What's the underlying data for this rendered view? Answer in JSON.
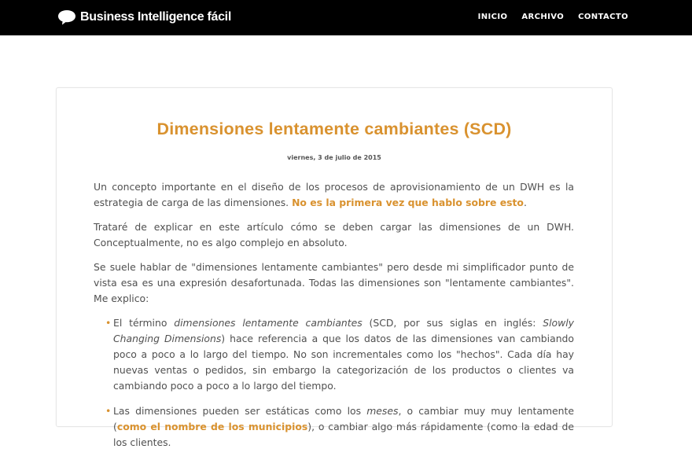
{
  "header": {
    "brand": "Business Intelligence fácil",
    "nav": [
      "INICIO",
      "ARCHIVO",
      "CONTACTO"
    ]
  },
  "post": {
    "title": "Dimensiones lentamente cambiantes (SCD)",
    "date": "viernes, 3 de julio de 2015",
    "p1_text": "Un concepto importante en el diseño de los procesos de aprovisionamiento de un DWH es la estrategia de carga de las dimensiones. ",
    "p1_link": "No es la primera vez que hablo sobre esto",
    "p1_end": ".",
    "p2": "Trataré de explicar en este artículo cómo se deben cargar las dimensiones de un DWH. Conceptualmente, no es algo complejo en absoluto.",
    "p3": "Se suele hablar de \"dimensiones lentamente cambiantes\" pero desde mi simplificador punto de vista esa es una expresión desafortunada. Todas las dimensiones son \"lentamente cambiantes\". Me explico:",
    "b1_a": "El término ",
    "b1_em1": "dimensiones lentamente cambiantes",
    "b1_b": " (SCD, por sus siglas en inglés: ",
    "b1_em2": "Slowly Changing Dimensions",
    "b1_c": ") hace referencia a que los datos de las dimensiones van cambiando poco a poco a lo largo del tiempo. No son incrementales como los \"hechos\". Cada día hay nuevas ventas o pedidos, sin embargo la categorización de los productos o clientes va cambiando poco a poco a lo largo del tiempo.",
    "b2_a": "Las dimensiones pueden ser estáticas como los ",
    "b2_em": "meses",
    "b2_b": ", o cambiar muy muy lentamente (",
    "b2_link": "como el nombre de los municipios",
    "b2_c": "), o cambiar algo más rápidamente (como la edad de los clientes."
  },
  "colors": {
    "accent": "#d9922f",
    "topbar": "#000000"
  }
}
